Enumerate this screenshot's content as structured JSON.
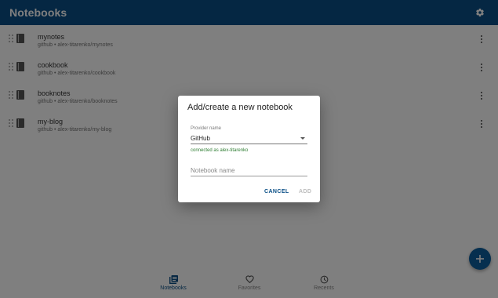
{
  "app_bar": {
    "title": "Notebooks",
    "settings_icon": "gear-icon"
  },
  "notebooks": [
    {
      "name": "mynotes",
      "source": "github • alex-titarenko/mynotes"
    },
    {
      "name": "cookbook",
      "source": "github • alex-titarenko/cookbook"
    },
    {
      "name": "booknotes",
      "source": "github • alex-titarenko/booknotes"
    },
    {
      "name": "my-blog",
      "source": "github • alex-titarenko/my-blog"
    }
  ],
  "dialog": {
    "title": "Add/create a new notebook",
    "provider_label": "Provider name",
    "provider_value": "GitHub",
    "connection_status": "connected as alex-titarenko",
    "notebook_name_placeholder": "Notebook name",
    "cancel_label": "CANCEL",
    "add_label": "ADD"
  },
  "bottom_nav": [
    {
      "label": "Notebooks",
      "icon": "library-books-icon",
      "active": true
    },
    {
      "label": "Favorites",
      "icon": "heart-icon",
      "active": false
    },
    {
      "label": "Recents",
      "icon": "clock-icon",
      "active": false
    }
  ],
  "colors": {
    "primary": "#0a4f86",
    "fab": "#0d5e9e",
    "success": "#2e7d32",
    "disabled": "#bdbdbd"
  }
}
